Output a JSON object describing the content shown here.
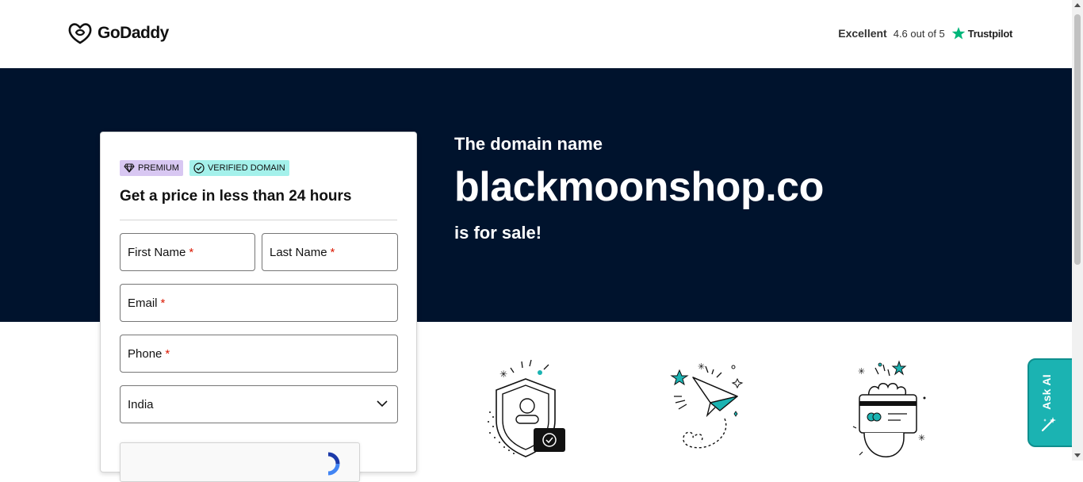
{
  "header": {
    "logo_text": "GoDaddy",
    "trust_label": "Excellent",
    "trust_score": "4.6 out of 5",
    "trust_brand": "Trustpilot",
    "trust_star_color": "#00b67a"
  },
  "hero": {
    "subtitle": "The domain name",
    "domain": "blackmoonshop.co",
    "tagline": "is for sale!",
    "background": "#00132d"
  },
  "form": {
    "badges": [
      {
        "label": "PREMIUM",
        "icon": "diamond-icon",
        "color": "#d8c7f2"
      },
      {
        "label": "VERIFIED DOMAIN",
        "icon": "check-circle-icon",
        "color": "#a4f1eb"
      }
    ],
    "title": "Get a price in less than 24 hours",
    "first_name_placeholder": "First Name",
    "last_name_placeholder": "Last Name",
    "email_placeholder": "Email",
    "phone_placeholder": "Phone",
    "required_mark": "*",
    "country_selected": "India"
  },
  "features": [
    {
      "icon": "security-shield-icon"
    },
    {
      "icon": "paper-plane-icon"
    },
    {
      "icon": "payment-card-icon"
    }
  ],
  "ask_ai": {
    "label": "Ask AI",
    "color": "#1bb3b2"
  }
}
